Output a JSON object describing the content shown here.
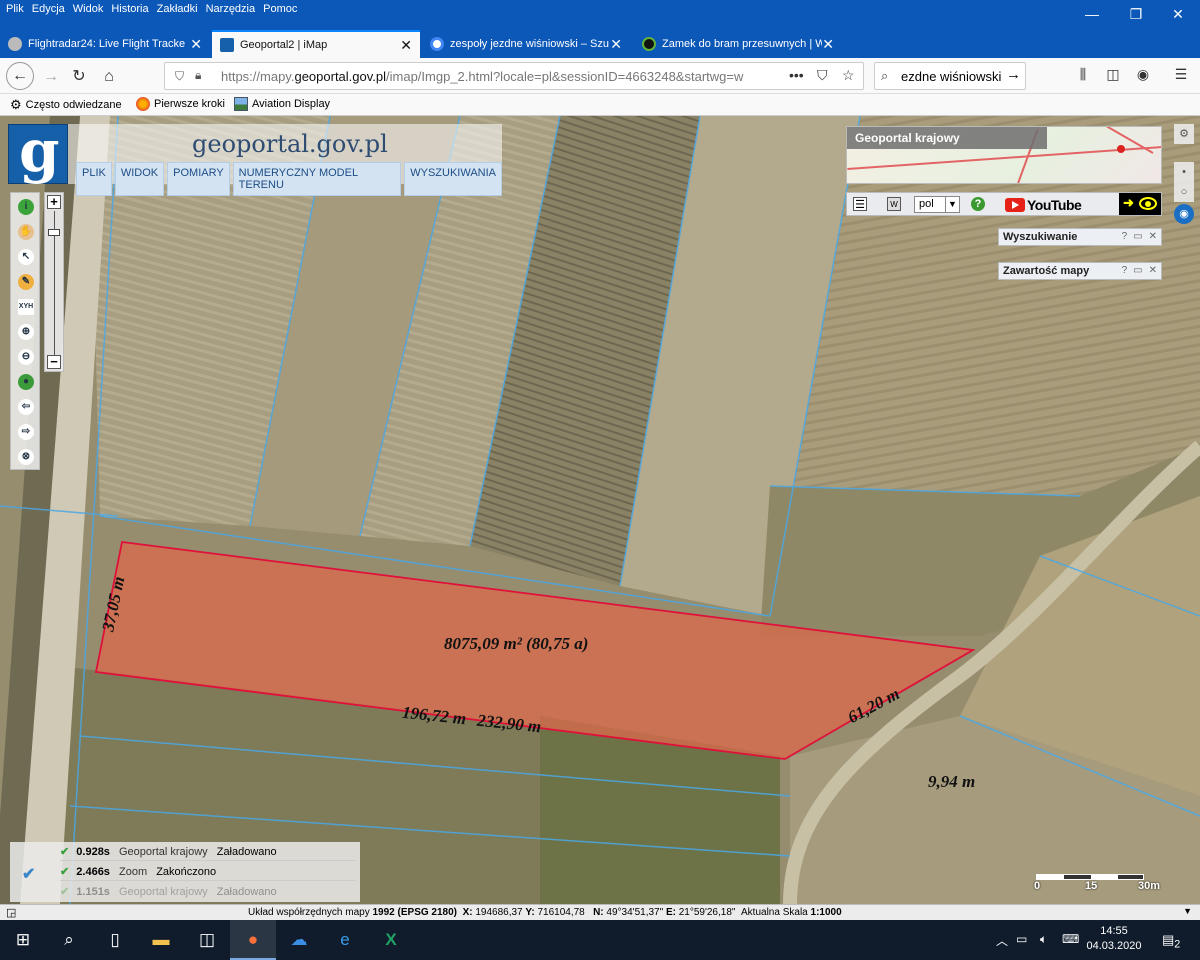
{
  "browser": {
    "menu": [
      "Plik",
      "Edycja",
      "Widok",
      "Historia",
      "Zakładki",
      "Narzędzia",
      "Pomoc"
    ],
    "window_controls": {
      "minimize": "—",
      "maximize": "❐",
      "close": "✕"
    },
    "tabs": [
      {
        "title": "Flightradar24: Live Flight Tracke",
        "active": false,
        "favicon_color": "#bbbbbb"
      },
      {
        "title": "Geoportal2 | iMap",
        "active": true,
        "favicon_color": "#1560a8"
      },
      {
        "title": "zespoły jezdne wiśniowski – Szu",
        "active": false,
        "favicon_color": "#4285f4"
      },
      {
        "title": "Zamek do bram przesuwnych | W",
        "active": false,
        "favicon_color": "#63b33b"
      }
    ],
    "new_tab": "+",
    "url_prefix": "https://mapy.",
    "url_domain": "geoportal.gov.pl",
    "url_rest": "/imap/Imgp_2.html?locale=pl&sessionID=4663248&startwg=w",
    "url_actions": {
      "more": "•••",
      "pocket": "⛉",
      "bookmark": "☆"
    },
    "search_value": "ezdne wiśniowski",
    "toolbar_icons": {
      "library": "⫼",
      "sidebar": "◫",
      "account": "◉",
      "menu": "☰"
    },
    "nav_icons": {
      "back": "←",
      "forward": "→",
      "reload": "↻",
      "home": "⌂"
    },
    "bookmarks": [
      {
        "label": "Często odwiedzane",
        "icon": "gear-icon"
      },
      {
        "label": "Pierwsze kroki",
        "icon": "firefox-icon"
      },
      {
        "label": "Aviation Display",
        "icon": "image-icon"
      }
    ]
  },
  "app": {
    "logo_letter": "g",
    "site_title": "geoportal.gov.pl",
    "menu": [
      "PLIK",
      "WIDOK",
      "POMIARY",
      "NUMERYCZNY MODEL TERENU",
      "WYSZUKIWANIA"
    ],
    "overview_title": "Geoportal krajowy",
    "language": "pol",
    "youtube_label": "YouTube",
    "panels": [
      {
        "title": "Wyszukiwanie",
        "buttons": [
          "?",
          "▭",
          "✕"
        ]
      },
      {
        "title": "Zawartość mapy",
        "buttons": [
          "?",
          "▭",
          "✕"
        ]
      }
    ],
    "zoom": {
      "plus": "+",
      "minus": "−"
    },
    "tools": [
      {
        "name": "info-icon",
        "glyph": "i",
        "color": "#3aa33a"
      },
      {
        "name": "pan-hand-icon",
        "glyph": "✋",
        "color": "#e8c090"
      },
      {
        "name": "select-arrow-icon",
        "glyph": "↖",
        "color": "#ffffff"
      },
      {
        "name": "pencil-icon",
        "glyph": "✎",
        "color": "#f0b040"
      },
      {
        "name": "xyh-coordinate-icon",
        "glyph": "XYH",
        "color": "#ffffff"
      },
      {
        "name": "zoom-in-icon",
        "glyph": "⊕",
        "color": "#ffffff"
      },
      {
        "name": "zoom-out-icon",
        "glyph": "⊖",
        "color": "#ffffff"
      },
      {
        "name": "globe-icon",
        "glyph": "●",
        "color": "#3b9b3b"
      },
      {
        "name": "back-arrow-icon",
        "glyph": "⇦",
        "color": "#ffffff"
      },
      {
        "name": "forward-arrow-icon",
        "glyph": "⇨",
        "color": "#ffffff"
      },
      {
        "name": "clear-icon",
        "glyph": "⊗",
        "color": "#ffffff"
      }
    ]
  },
  "measurements": {
    "area": "8075,09 m² (80,75 a)",
    "edge_left": "37,05 m",
    "edge_bottom_a": "196,72 m",
    "edge_bottom_b": "232,90 m",
    "edge_right": "61,20 m",
    "extra": "9,94 m"
  },
  "load_log": {
    "check": "✔",
    "rows": [
      {
        "time": "0.928s",
        "name": "Geoportal krajowy",
        "status": "Załadowano",
        "faded": false
      },
      {
        "time": "2.466s",
        "name": "Zoom",
        "status": "Zakończono",
        "faded": false
      },
      {
        "time": "1.151s",
        "name": "Geoportal krajowy",
        "status": "Załadowano",
        "faded": true
      }
    ]
  },
  "scale": {
    "labels": [
      "0",
      "15",
      "30m"
    ]
  },
  "status": {
    "crs_label": "Układ współrzędnych mapy",
    "crs_value": "1992 (EPSG 2180)",
    "x_label": "X:",
    "x_value": "194686,37",
    "y_label": "Y:",
    "y_value": "716104,78",
    "n_label": "N:",
    "n_value": "49°34'51,37\"",
    "e_label": "E:",
    "e_value": "21°59'26,18\"",
    "scale_label": "Aktualna Skala",
    "scale_value": "1:1000"
  },
  "taskbar": {
    "time": "14:55",
    "date": "04.03.2020",
    "notifications": "2"
  }
}
